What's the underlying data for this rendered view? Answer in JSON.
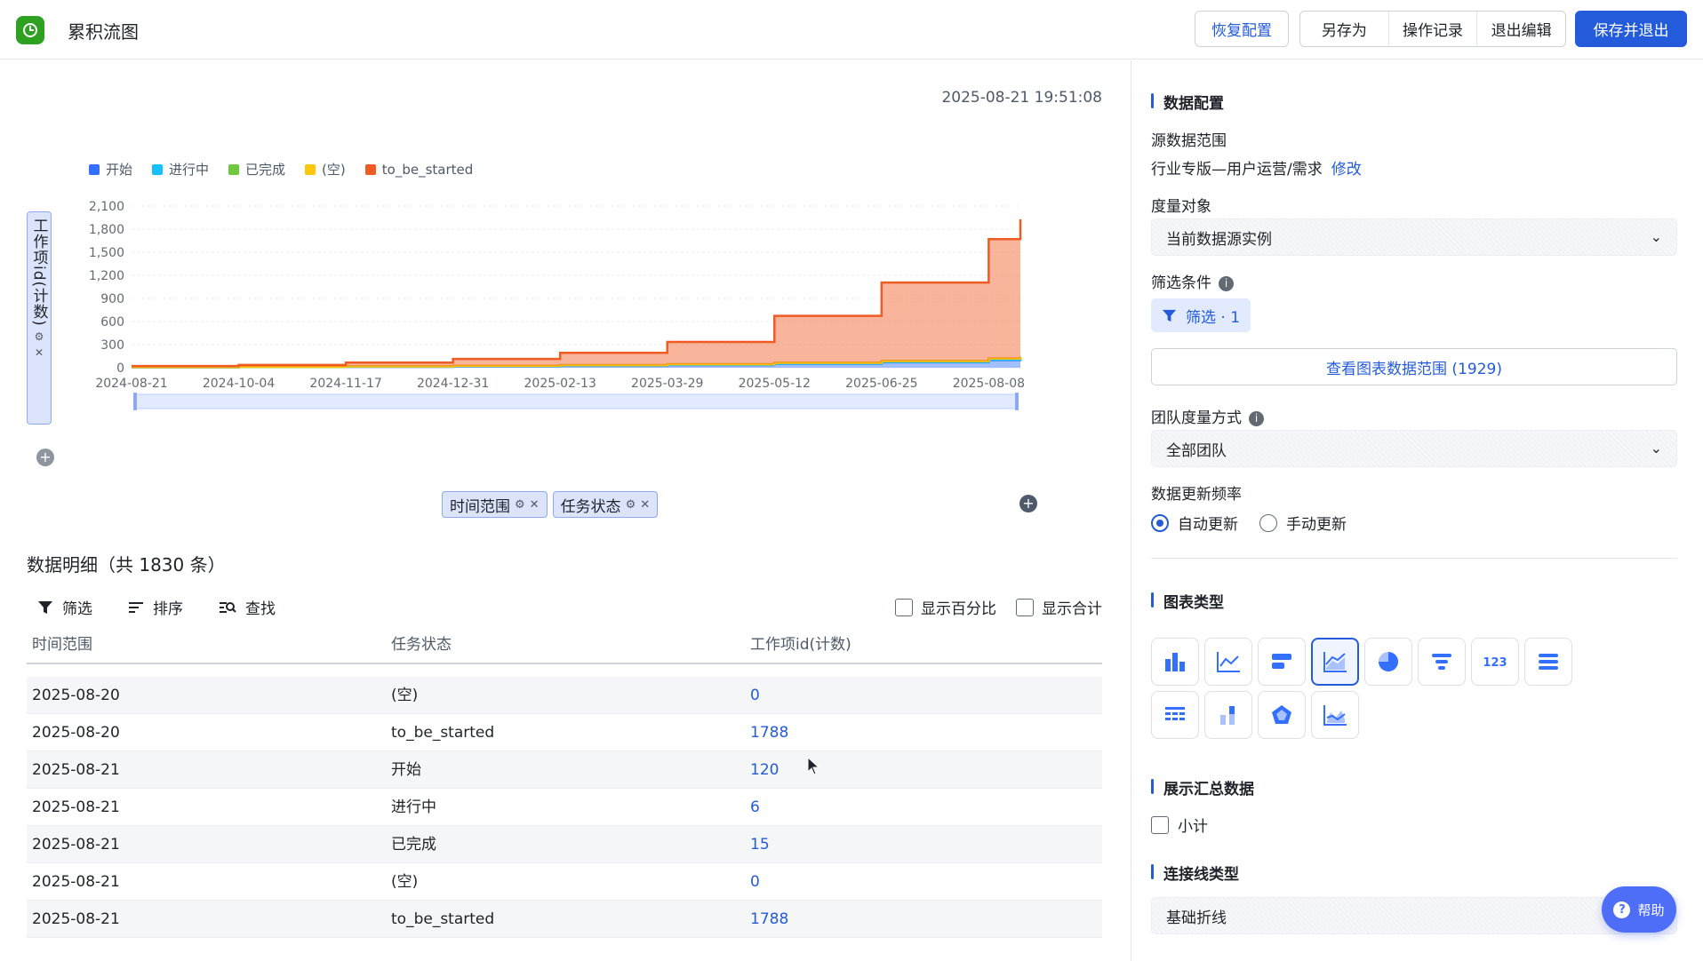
{
  "app": {
    "title": "累积流图"
  },
  "header": {
    "restore_label": "恢复配置",
    "save_as_label": "另存为",
    "history_label": "操作记录",
    "exit_edit_label": "退出编辑",
    "save_exit_label": "保存并退出"
  },
  "main": {
    "timestamp": "2025-08-21 19:51:08",
    "y_axis_tag": "工作项id(计数)",
    "chips": [
      {
        "label": "时间范围"
      },
      {
        "label": "任务状态"
      }
    ],
    "detail_title": "数据明细（共 1830 条）",
    "toolbar": {
      "filter": "筛选",
      "sort": "排序",
      "find": "查找"
    },
    "show_percent": "显示百分比",
    "show_total": "显示合计",
    "table": {
      "columns": [
        "时间范围",
        "任务状态",
        "工作项id(计数)"
      ],
      "rows": [
        [
          "2025-08-20",
          "(空)",
          "0"
        ],
        [
          "2025-08-20",
          "to_be_started",
          "1788"
        ],
        [
          "2025-08-21",
          "开始",
          "120"
        ],
        [
          "2025-08-21",
          "进行中",
          "6"
        ],
        [
          "2025-08-21",
          "已完成",
          "15"
        ],
        [
          "2025-08-21",
          "(空)",
          "0"
        ],
        [
          "2025-08-21",
          "to_be_started",
          "1788"
        ]
      ]
    }
  },
  "chart_data": {
    "type": "area",
    "stacked": true,
    "ylabel": "工作项id(计数)",
    "ylim": [
      0,
      2100
    ],
    "yticks": [
      "2,100",
      "1,800",
      "1,500",
      "1,200",
      "900",
      "600",
      "300",
      "0"
    ],
    "x_tick_labels": [
      "2024-08-21",
      "2024-10-04",
      "2024-11-17",
      "2024-12-31",
      "2025-02-13",
      "2025-03-29",
      "2025-05-12",
      "2025-06-25",
      "2025-08-08"
    ],
    "legend_position": "top-left",
    "x": [
      "2024-08-21",
      "2024-10-04",
      "2024-11-17",
      "2024-12-31",
      "2025-02-13",
      "2025-03-29",
      "2025-05-12",
      "2025-06-25",
      "2025-08-08",
      "2025-08-21"
    ],
    "series": [
      {
        "name": "开始",
        "color": "#3370ff",
        "values": [
          5,
          8,
          12,
          18,
          25,
          35,
          50,
          70,
          100,
          120
        ]
      },
      {
        "name": "进行中",
        "color": "#14c0ff",
        "values": [
          1,
          1,
          2,
          2,
          3,
          3,
          4,
          5,
          6,
          6
        ]
      },
      {
        "name": "已完成",
        "color": "#6fc840",
        "values": [
          1,
          2,
          3,
          4,
          5,
          7,
          9,
          11,
          14,
          15
        ]
      },
      {
        "name": "(空)",
        "color": "#ffc60a",
        "values": [
          0,
          0,
          0,
          0,
          0,
          0,
          0,
          0,
          0,
          0
        ]
      },
      {
        "name": "to_be_started",
        "color": "#f05a23",
        "values": [
          15,
          25,
          50,
          90,
          160,
          290,
          610,
          1020,
          1550,
          1788
        ]
      }
    ]
  },
  "panel": {
    "data_config_title": "数据配置",
    "source_label": "源数据范围",
    "source_value": "行业专版—用户运营/需求",
    "source_edit": "修改",
    "measure_label": "度量对象",
    "measure_value": "当前数据源实例",
    "filter_label": "筛选条件",
    "filter_chip": "筛选 · 1",
    "view_range_button": "查看图表数据范围 (1929)",
    "team_measure_label": "团队度量方式",
    "team_measure_value": "全部团队",
    "update_freq_label": "数据更新频率",
    "auto_update": "自动更新",
    "manual_update": "手动更新",
    "chart_type_title": "图表类型",
    "chart_types": [
      "column",
      "line",
      "bar",
      "cumulative-flow",
      "pie",
      "funnel",
      "number",
      "list",
      "table",
      "stacked-column",
      "radar",
      "area-line"
    ],
    "summary_title": "展示汇总数据",
    "subtotal_label": "小计",
    "line_type_title": "连接线类型",
    "line_type_value": "基础折线",
    "help_label": "帮助"
  }
}
